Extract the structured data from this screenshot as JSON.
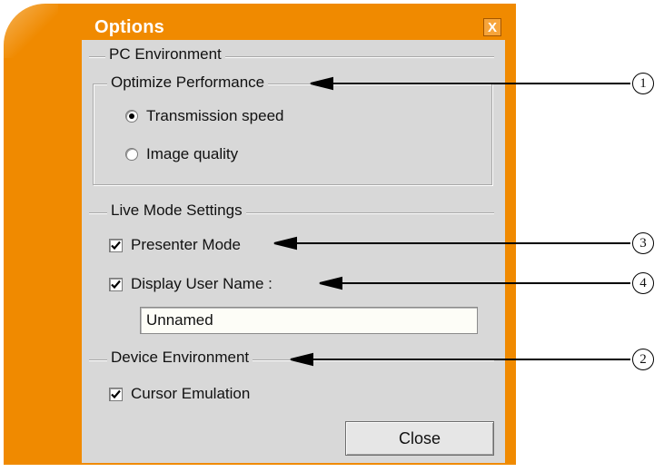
{
  "window": {
    "title": "Options",
    "close_glyph": "X"
  },
  "sections": {
    "pc_environment": "PC Environment",
    "optimize_performance": "Optimize Performance",
    "live_mode_settings": "Live Mode Settings",
    "device_environment": "Device Environment"
  },
  "optimize": {
    "options": [
      {
        "label": "Transmission speed",
        "selected": true
      },
      {
        "label": "Image quality",
        "selected": false
      }
    ]
  },
  "live": {
    "presenter_mode": {
      "label": "Presenter Mode",
      "checked": true
    },
    "display_user_name": {
      "label": "Display User Name :",
      "checked": true
    },
    "user_name_value": "Unnamed"
  },
  "device": {
    "cursor_emulation": {
      "label": "Cursor Emulation",
      "checked": true
    }
  },
  "buttons": {
    "close_label": "Close"
  },
  "callouts": [
    {
      "num": "1",
      "target": "Optimize Performance"
    },
    {
      "num": "3",
      "target": "Presenter Mode"
    },
    {
      "num": "4",
      "target": "Display User Name :"
    },
    {
      "num": "2",
      "target": "Device Environment"
    }
  ],
  "colors": {
    "frame_orange": "#f08a00",
    "panel_gray": "#d8d8d8"
  }
}
